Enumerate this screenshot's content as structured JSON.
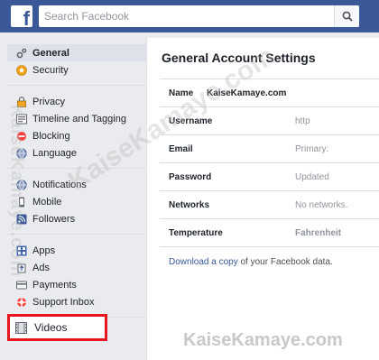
{
  "header": {
    "logo_letter": "f",
    "search_placeholder": "Search Facebook"
  },
  "sidebar": {
    "groups": [
      [
        {
          "label": "General",
          "icon": "gear-icon",
          "active": true
        },
        {
          "label": "Security",
          "icon": "shield-icon"
        }
      ],
      [
        {
          "label": "Privacy",
          "icon": "lock-icon"
        },
        {
          "label": "Timeline and Tagging",
          "icon": "timeline-icon"
        },
        {
          "label": "Blocking",
          "icon": "block-icon"
        },
        {
          "label": "Language",
          "icon": "globe-icon"
        }
      ],
      [
        {
          "label": "Notifications",
          "icon": "globe-icon"
        },
        {
          "label": "Mobile",
          "icon": "mobile-icon"
        },
        {
          "label": "Followers",
          "icon": "rss-icon"
        }
      ],
      [
        {
          "label": "Apps",
          "icon": "apps-icon"
        },
        {
          "label": "Ads",
          "icon": "ads-icon"
        },
        {
          "label": "Payments",
          "icon": "card-icon"
        },
        {
          "label": "Support Inbox",
          "icon": "lifebuoy-icon"
        }
      ]
    ],
    "highlighted_item": {
      "label": "Videos",
      "icon": "video-icon"
    }
  },
  "main": {
    "title": "General Account Settings",
    "rows": [
      {
        "key": "Name",
        "value": "KaiseKamaye.com",
        "style": "strong"
      },
      {
        "key": "Username",
        "value": "http",
        "style": "plain"
      },
      {
        "key": "Email",
        "value": "Primary:",
        "style": "plain"
      },
      {
        "key": "Password",
        "value": "Updated",
        "style": "plain"
      },
      {
        "key": "Networks",
        "value": "No networks.",
        "style": "plain"
      },
      {
        "key": "Temperature",
        "value": "Fahrenheit",
        "style": "muted"
      }
    ],
    "download_prefix": "Download a copy",
    "download_suffix": " of your Facebook data."
  },
  "watermarks": {
    "diagonal": "KaiseKamaye.com",
    "vertical": "KaiseKamaye.com",
    "bottom": "KaiseKamaye.com"
  },
  "colors": {
    "brand": "#3b5998",
    "highlight_border": "#e8141e",
    "link": "#365899"
  }
}
